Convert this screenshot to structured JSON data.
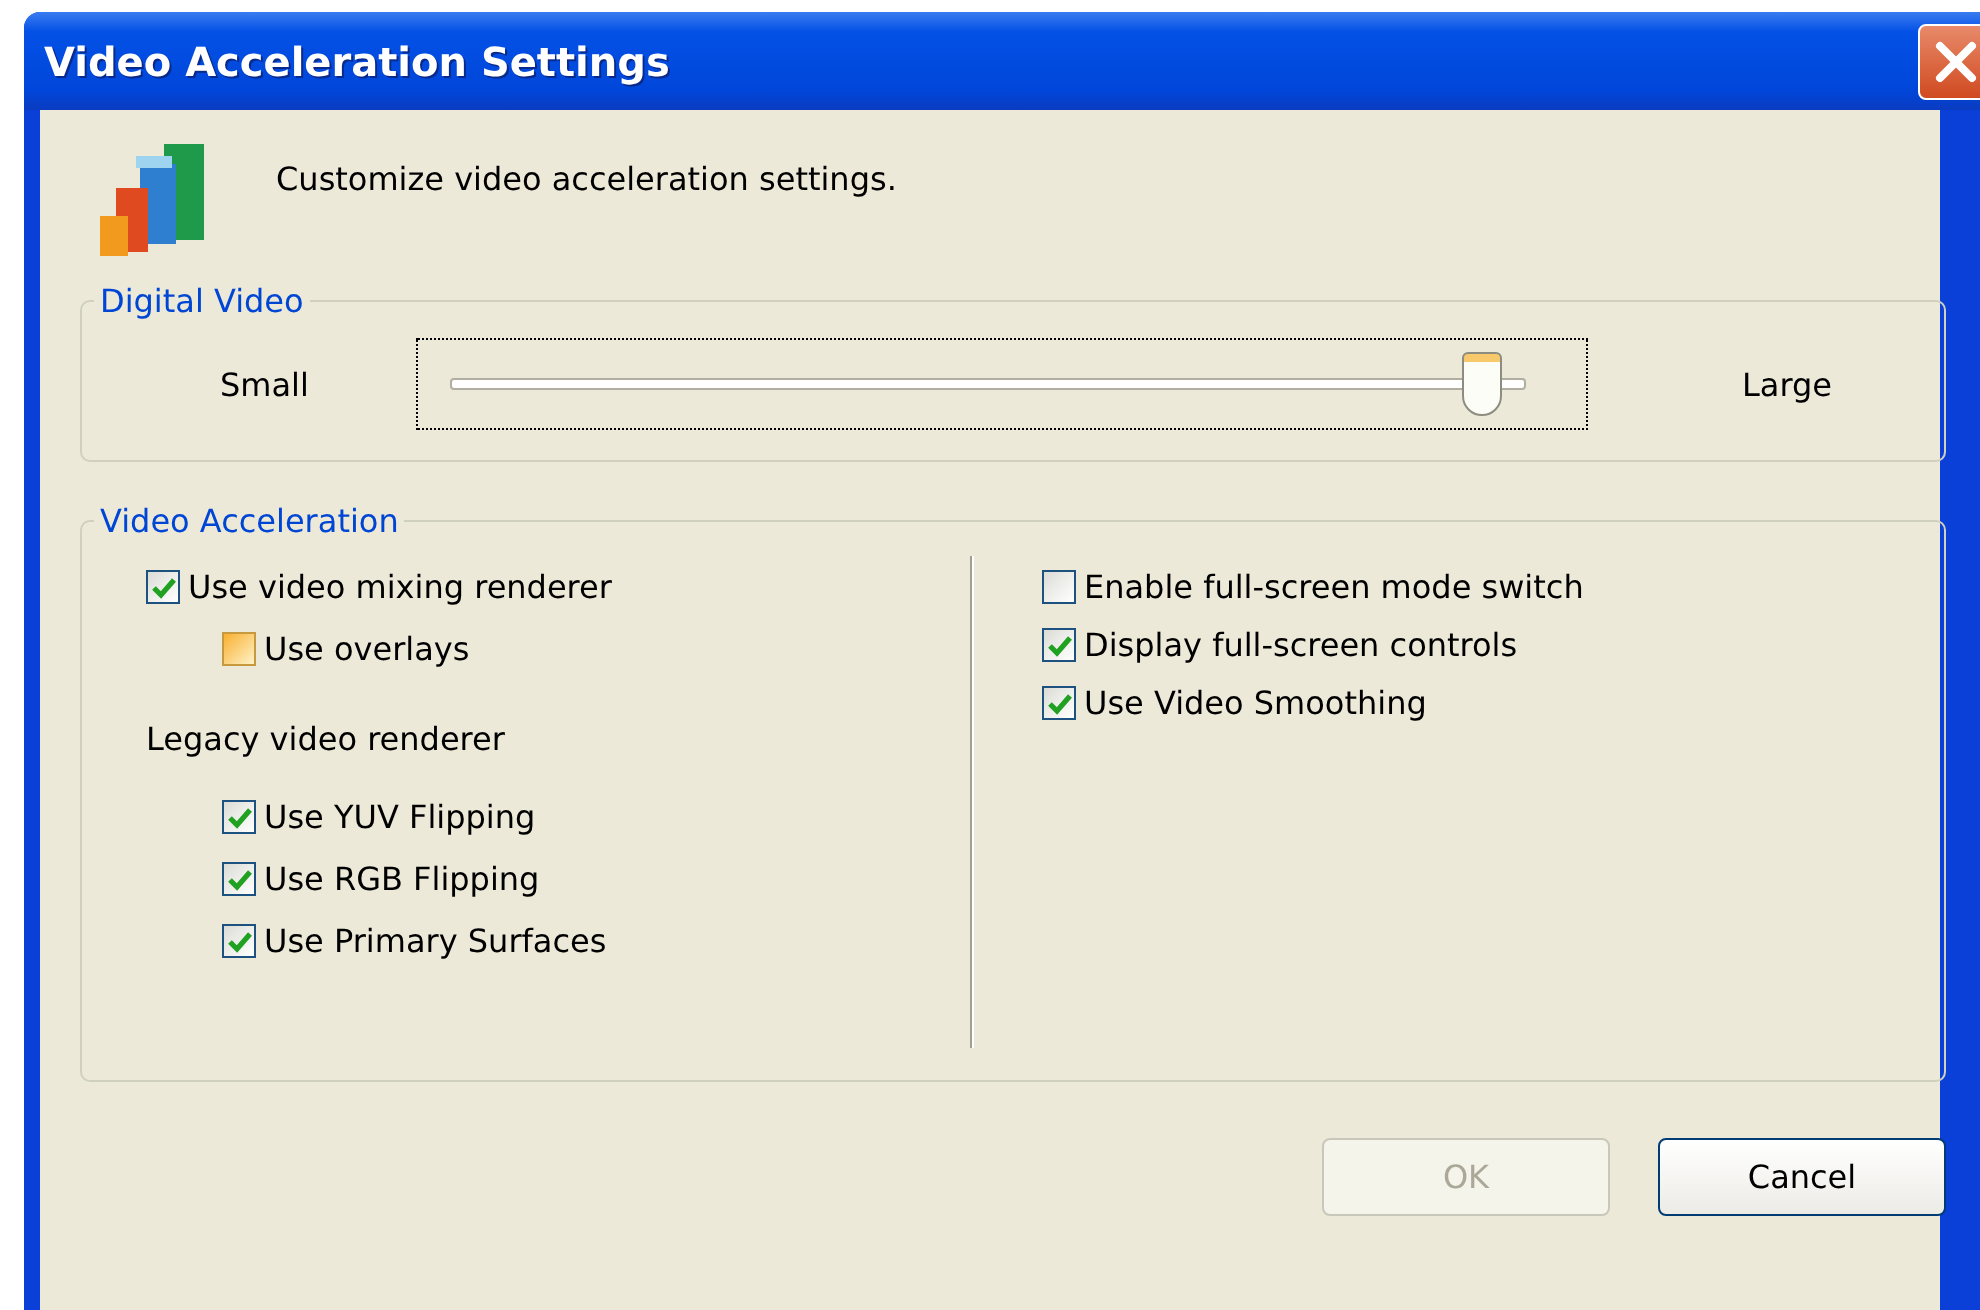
{
  "window": {
    "title": "Video Acceleration Settings"
  },
  "header": {
    "text": "Customize video acceleration settings."
  },
  "digital_video": {
    "label": "Digital Video",
    "min_label": "Small",
    "max_label": "Large",
    "level": 0.96,
    "focused": true
  },
  "video_acceleration": {
    "label": "Video Acceleration",
    "left": [
      {
        "kind": "checkbox",
        "label": "Use video mixing renderer",
        "checked": true,
        "hot": false,
        "children": [
          {
            "kind": "checkbox",
            "label": "Use overlays",
            "checked": false,
            "hot": true
          }
        ]
      },
      {
        "kind": "heading",
        "label": "Legacy video renderer",
        "children": [
          {
            "kind": "checkbox",
            "label": "Use YUV Flipping",
            "checked": true,
            "hot": false
          },
          {
            "kind": "checkbox",
            "label": "Use RGB Flipping",
            "checked": true,
            "hot": false
          },
          {
            "kind": "checkbox",
            "label": "Use Primary Surfaces",
            "checked": true,
            "hot": false
          }
        ]
      }
    ],
    "right": [
      {
        "kind": "checkbox",
        "label": "Enable full-screen mode switch",
        "checked": false,
        "hot": false
      },
      {
        "kind": "checkbox",
        "label": "Display full-screen controls",
        "checked": true,
        "hot": false
      },
      {
        "kind": "checkbox",
        "label": "Use Video Smoothing",
        "checked": true,
        "hot": false
      }
    ]
  },
  "buttons": [
    {
      "label": "OK",
      "disabled": true
    },
    {
      "label": "Cancel",
      "disabled": false
    }
  ]
}
